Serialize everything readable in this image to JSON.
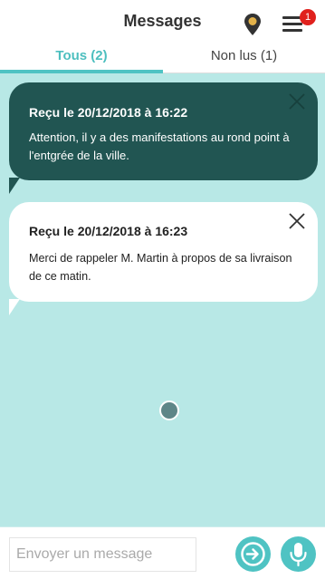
{
  "header": {
    "title": "Messages",
    "notification_count": "1",
    "icons": {
      "location": "location-pin-icon",
      "menu": "hamburger-menu-icon"
    }
  },
  "tabs": [
    {
      "label": "Tous (2)",
      "active": true
    },
    {
      "label": "Non lus (1)",
      "active": false
    }
  ],
  "messages": [
    {
      "date": "Reçu le 20/12/2018 à 16:22",
      "text": "Attention, il y a des manifestations au rond point à l'entgrée de la ville.",
      "read": false
    },
    {
      "date": "Reçu le 20/12/2018 à 16:23",
      "text": "Merci de rappeler M. Martin à propos de sa livraison de ce matin.",
      "read": true
    }
  ],
  "composer": {
    "placeholder": "Envoyer un message",
    "value": ""
  },
  "colors": {
    "accent": "#4fc3c3",
    "background": "#b8e8e6",
    "unread_bubble": "#215552",
    "read_bubble": "#ffffff",
    "badge": "#e0211d"
  }
}
